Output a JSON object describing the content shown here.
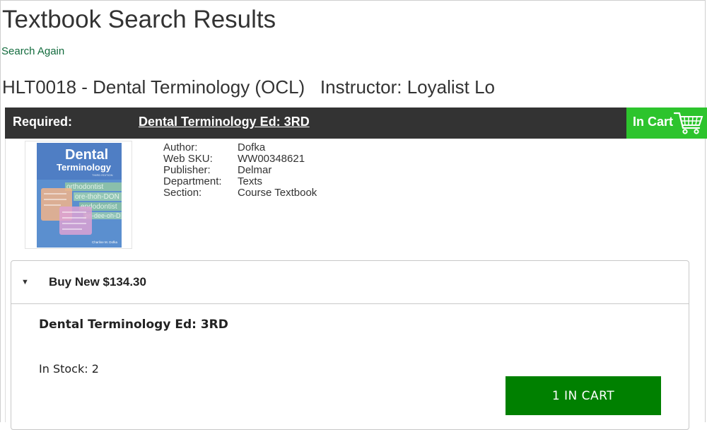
{
  "page": {
    "title": "Textbook Search Results",
    "search_again": "Search Again",
    "course_line": "HLT0018 - Dental Terminology (OCL)   Instructor: Loyalist Lo"
  },
  "requirement": {
    "label": "Required:",
    "book_title": "Dental Terminology Ed: 3RD",
    "status": "In Cart",
    "status_icon": "shopping-cart-icon",
    "bar_color": "#333333",
    "status_color": "#2DC42D"
  },
  "cover": {
    "title_line1": "Dental",
    "title_line2": "Terminology",
    "edition": "THIRD EDITION",
    "author": "Charline M. Dofka",
    "cover_words": [
      "orthodontist",
      "ore-thoh-DON",
      "endodontist",
      "en-dee-oh-D"
    ]
  },
  "book": {
    "fields": [
      {
        "key": "Author:",
        "value": "Dofka"
      },
      {
        "key": "Web SKU:",
        "value": "WW00348621"
      },
      {
        "key": "Publisher:",
        "value": "Delmar"
      },
      {
        "key": "Department:",
        "value": "Texts"
      },
      {
        "key": "Section:",
        "value": "Course Textbook"
      }
    ]
  },
  "buy": {
    "label": "Buy New $134.30",
    "caret_icon": "caret-down-icon",
    "item_title": "Dental Terminology Ed: 3RD",
    "stock": "In Stock: 2",
    "cart_button": "1 IN CART",
    "button_color": "#008000"
  }
}
